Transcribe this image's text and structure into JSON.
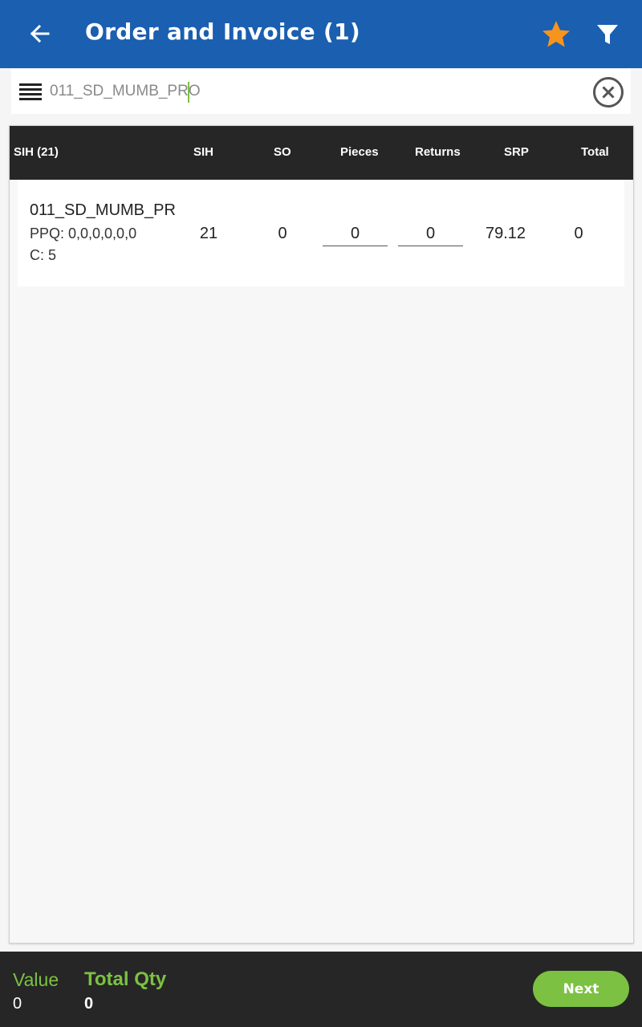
{
  "appbar": {
    "title": "Order and  Invoice (1)",
    "back_icon": "arrow-left-icon",
    "star_icon": "star-icon",
    "filter_icon": "filter-icon",
    "star_color": "#f7941d",
    "background": "#1a5fb0"
  },
  "search": {
    "value": "011_SD_MUMB_PRO",
    "menu_icon": "menu-icon",
    "clear_icon": "close-circle-icon"
  },
  "table": {
    "headers": [
      "SIH (21)",
      "SIH",
      "SO",
      "Pieces",
      "Returns",
      "SRP",
      "Total"
    ],
    "rows": [
      {
        "name": "011_SD_MUMB_PR",
        "ppq": "PPQ: 0,0,0,0,0,0",
        "c": "C: 5",
        "sih": "21",
        "so": "0",
        "pieces": "0",
        "returns": "0",
        "srp": "79.12",
        "total": "0"
      }
    ]
  },
  "footer": {
    "value_label": "Value",
    "value": "0",
    "total_qty_label": "Total Qty",
    "total_qty": "0",
    "next_label": "Next",
    "accent": "#7cc142"
  }
}
